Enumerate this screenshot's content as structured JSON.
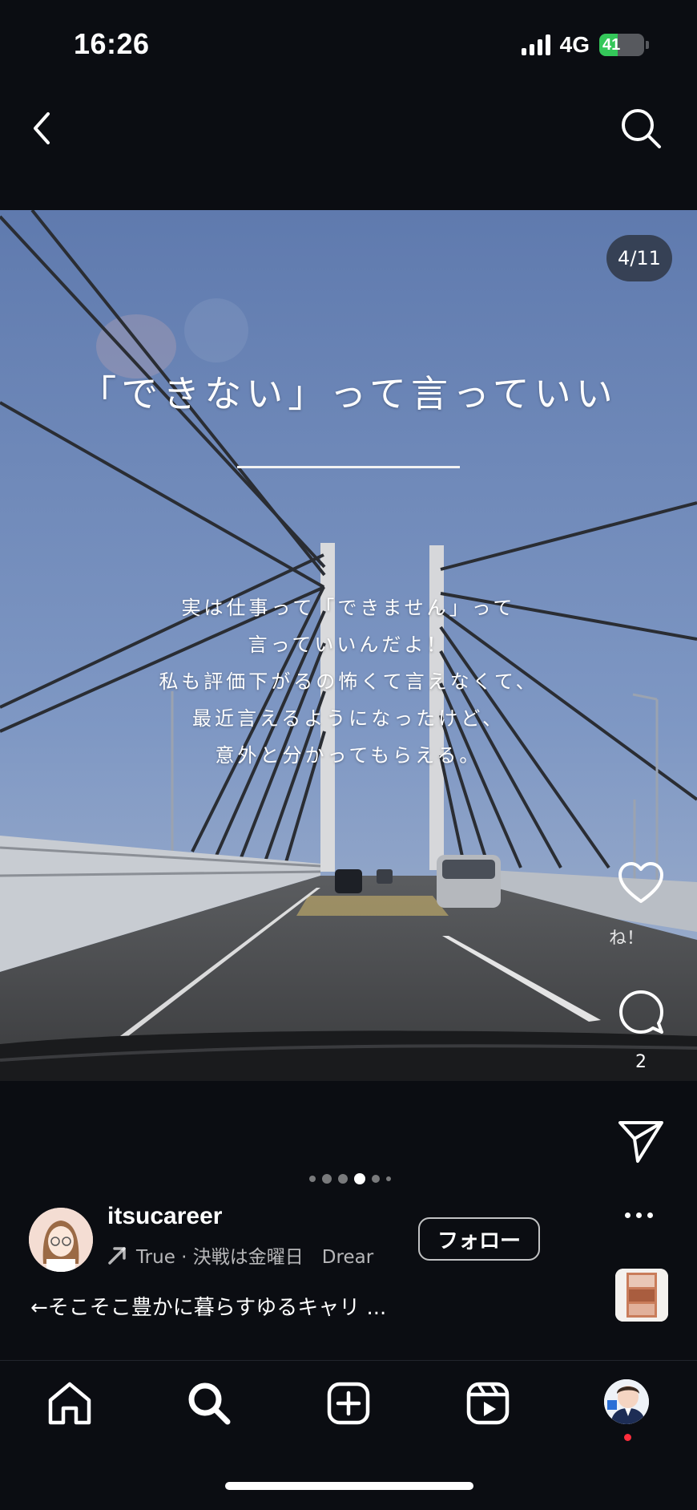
{
  "status_bar": {
    "time": "16:26",
    "network": "4G",
    "battery_percent": "41",
    "battery_level": 0.41,
    "battery_color": "#34c759"
  },
  "top_nav": {
    "back_icon": "chevron-left-icon",
    "search_icon": "search-icon"
  },
  "post": {
    "slide_counter": "4/11",
    "current_slide": 4,
    "total_slides": 11,
    "headline": "「できない」って言っていい",
    "body_lines": [
      "実は仕事って「できません」って",
      "言っていいんだよ！",
      "私も評価下がるの怖くて言えなくて、",
      "最近言えるようになったけど、",
      "意外と分かってもらえる。"
    ]
  },
  "actions": {
    "like_icon": "heart-icon",
    "like_label": "ね！",
    "comment_icon": "comment-icon",
    "comment_count": "2",
    "share_icon": "paper-plane-icon",
    "more_icon": "more-dots-icon"
  },
  "author": {
    "username": "itsucareer",
    "music_icon": "trending-arrow-icon",
    "music_text": "True · 決戦は金曜日　Drear",
    "follow_label": "フォロー",
    "caption": "←そこそこ豊かに暮らすゆるキャリ ..."
  },
  "tab_bar": {
    "items": [
      "home-icon",
      "search-icon",
      "create-post-icon",
      "reels-icon",
      "profile-avatar"
    ],
    "notification_color": "#ff2d3c"
  }
}
